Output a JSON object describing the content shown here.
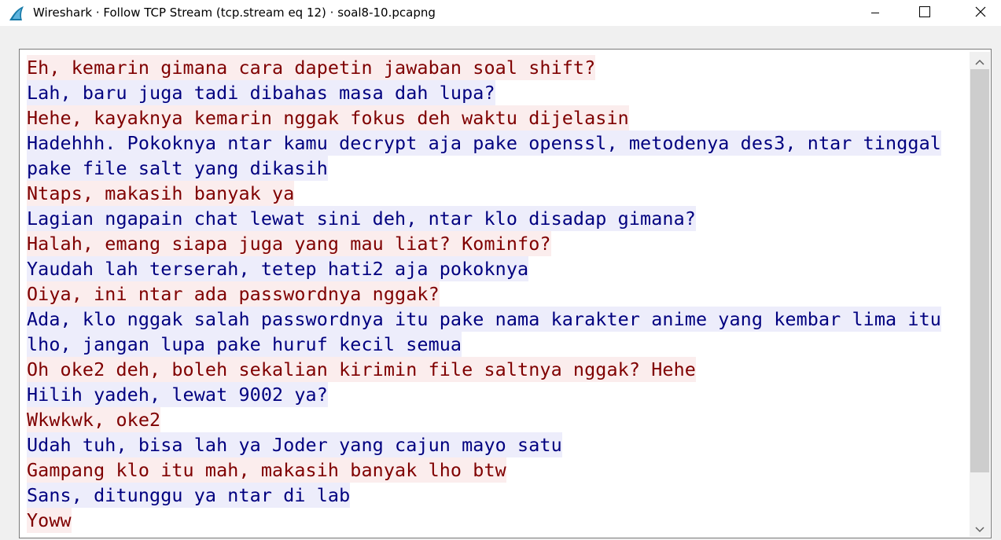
{
  "window": {
    "title": "Wireshark · Follow TCP Stream (tcp.stream eq 12) · soal8-10.pcapng",
    "icon": "wireshark-fin-icon",
    "controls": [
      "minimize-icon",
      "maximize-icon",
      "close-icon"
    ]
  },
  "colors": {
    "client_text": "#7f0000",
    "client_bg": "#fbeded",
    "server_text": "#00007f",
    "server_bg": "#ededfb"
  },
  "stream": {
    "lines": [
      {
        "dir": "client",
        "text": "Eh, kemarin gimana cara dapetin jawaban soal shift?"
      },
      {
        "dir": "server",
        "text": "Lah, baru juga tadi dibahas masa dah lupa?"
      },
      {
        "dir": "client",
        "text": "Hehe, kayaknya kemarin nggak fokus deh waktu dijelasin"
      },
      {
        "dir": "server",
        "text": "Hadehhh. Pokoknya ntar kamu decrypt aja pake openssl, metodenya des3, ntar tinggal"
      },
      {
        "dir": "server",
        "text": "pake file salt yang dikasih"
      },
      {
        "dir": "client",
        "text": "Ntaps, makasih banyak ya"
      },
      {
        "dir": "server",
        "text": "Lagian ngapain chat lewat sini deh, ntar klo disadap gimana?"
      },
      {
        "dir": "client",
        "text": "Halah, emang siapa juga yang mau liat? Kominfo?"
      },
      {
        "dir": "server",
        "text": "Yaudah lah terserah, tetep hati2 aja pokoknya"
      },
      {
        "dir": "client",
        "text": "Oiya, ini ntar ada passwordnya nggak?"
      },
      {
        "dir": "server",
        "text": "Ada, klo nggak salah passwordnya itu pake nama karakter anime yang kembar lima itu"
      },
      {
        "dir": "server",
        "text": "lho, jangan lupa pake huruf kecil semua"
      },
      {
        "dir": "client",
        "text": "Oh oke2 deh, boleh sekalian kirimin file saltnya nggak? Hehe"
      },
      {
        "dir": "server",
        "text": "Hilih yadeh, lewat 9002 ya?"
      },
      {
        "dir": "client",
        "text": "Wkwkwk, oke2"
      },
      {
        "dir": "server",
        "text": "Udah tuh, bisa lah ya Joder yang cajun mayo satu"
      },
      {
        "dir": "client",
        "text": "Gampang klo itu mah, makasih banyak lho btw"
      },
      {
        "dir": "server",
        "text": "Sans, ditunggu ya ntar di lab"
      },
      {
        "dir": "client",
        "text": "Yoww"
      }
    ]
  }
}
